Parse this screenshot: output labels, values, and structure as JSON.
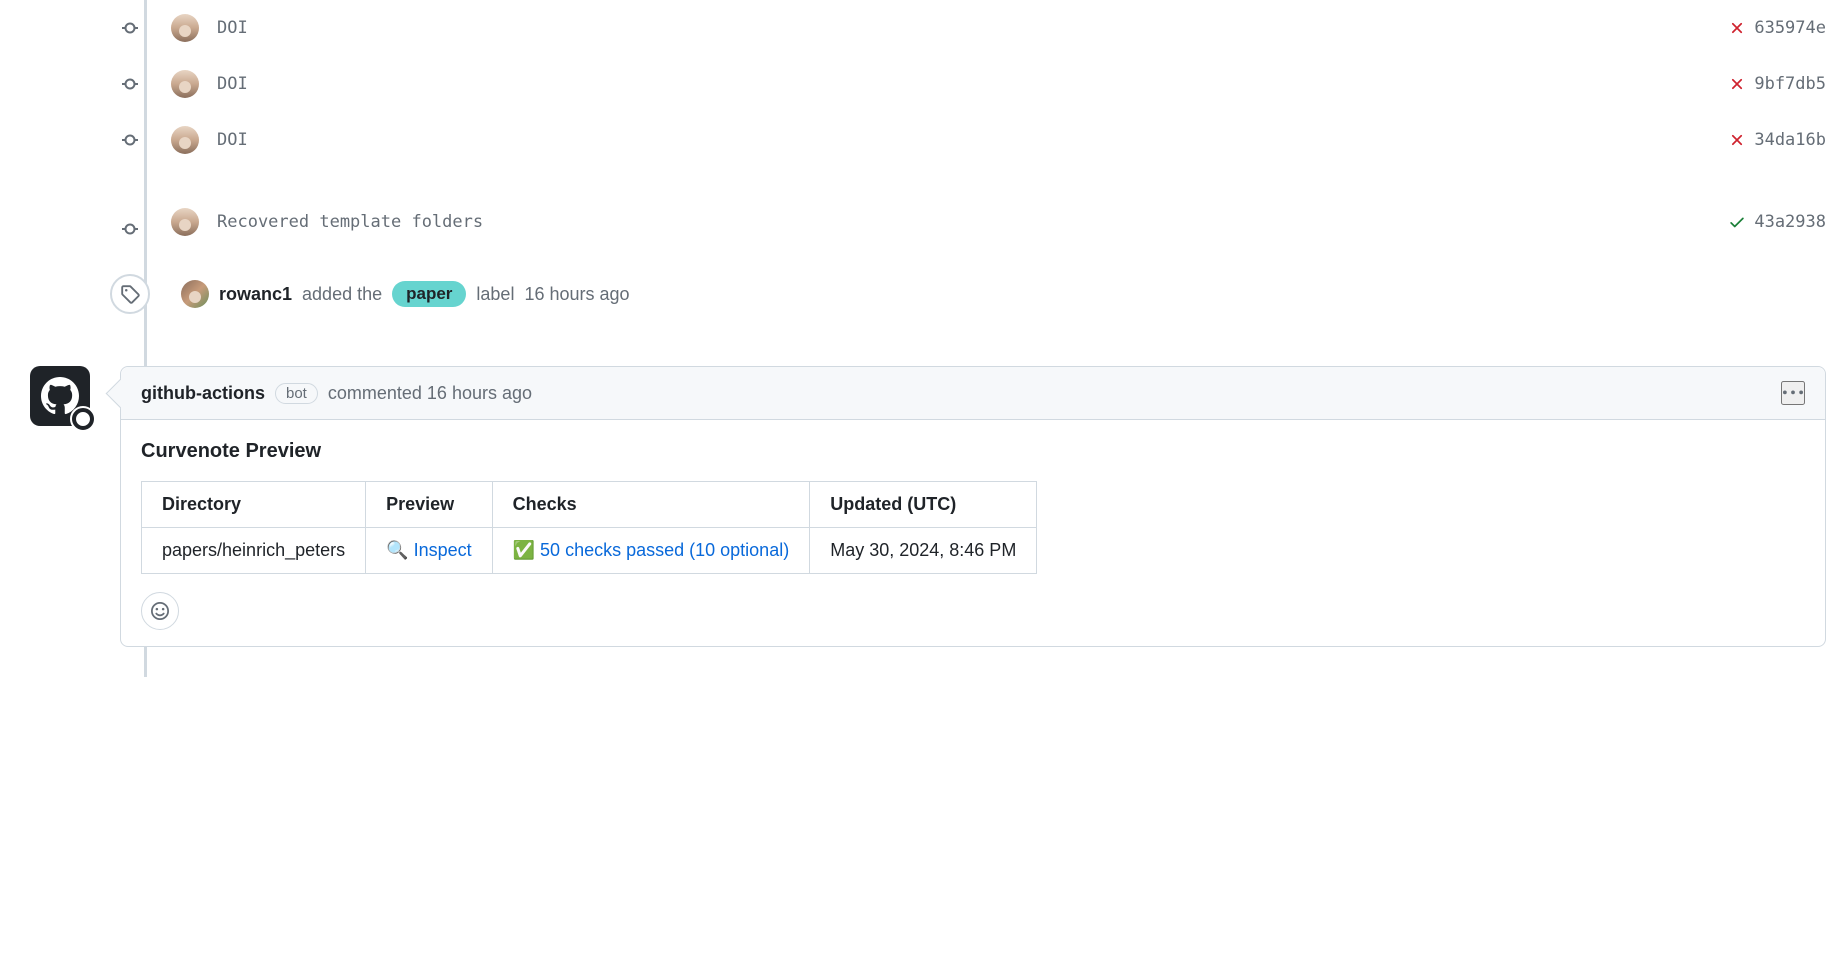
{
  "commits": [
    {
      "message": "DOI",
      "sha": "635974e",
      "status": "fail"
    },
    {
      "message": "DOI",
      "sha": "9bf7db5",
      "status": "fail"
    },
    {
      "message": "DOI",
      "sha": "34da16b",
      "status": "fail"
    },
    {
      "message": "Recovered template folders",
      "sha": "43a2938",
      "status": "pass"
    }
  ],
  "label_event": {
    "actor": "rowanc1",
    "action_prefix": "added the",
    "label": "paper",
    "action_suffix": "label",
    "time": "16 hours ago"
  },
  "comment": {
    "author": "github-actions",
    "bot_label": "bot",
    "meta_prefix": "commented",
    "time": "16 hours ago",
    "heading": "Curvenote Preview",
    "table": {
      "headers": [
        "Directory",
        "Preview",
        "Checks",
        "Updated (UTC)"
      ],
      "row": {
        "directory": "papers/heinrich_peters",
        "preview_icon": "🔍",
        "preview_text": "Inspect",
        "checks_icon": "✅",
        "checks_text": "50 checks passed (10 optional)",
        "updated": "May 30, 2024, 8:46 PM"
      }
    }
  }
}
